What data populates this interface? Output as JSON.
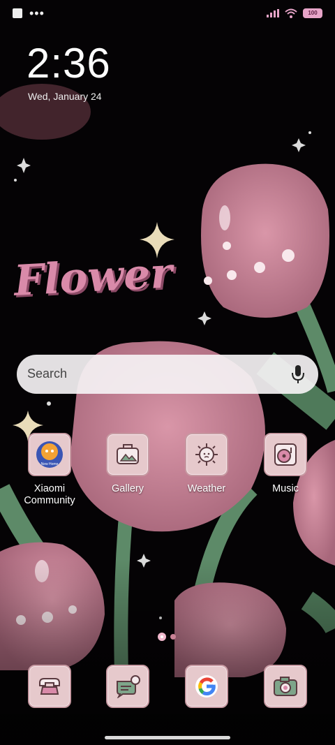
{
  "clock": {
    "time": "2:36",
    "date": "Wed, January 24"
  },
  "status_bar": {
    "battery": "100",
    "icons": [
      "notification-square-icon",
      "more-dots-icon",
      "signal-icon",
      "wifi-icon",
      "battery-icon"
    ]
  },
  "wallpaper": {
    "title": "Flower"
  },
  "search": {
    "placeholder": "Search"
  },
  "apps": [
    {
      "label": "Xiaomi Community",
      "line1": "Xiaomi",
      "line2": "Community",
      "icon": "xiaomi-community-icon",
      "badge_text": "New Home"
    },
    {
      "label": "Gallery",
      "icon": "gallery-icon"
    },
    {
      "label": "Weather",
      "icon": "weather-sun-icon"
    },
    {
      "label": "Music",
      "icon": "music-record-icon"
    }
  ],
  "dock": [
    {
      "name": "phone",
      "icon": "phone-icon"
    },
    {
      "name": "messages",
      "icon": "messages-icon"
    },
    {
      "name": "google",
      "icon": "google-icon"
    },
    {
      "name": "camera",
      "icon": "camera-icon"
    }
  ],
  "colors": {
    "accent_pink": "#e7a4c8",
    "icon_bg": "#e6c9cc",
    "tulip": "#c98396",
    "stem": "#5d8a68"
  }
}
